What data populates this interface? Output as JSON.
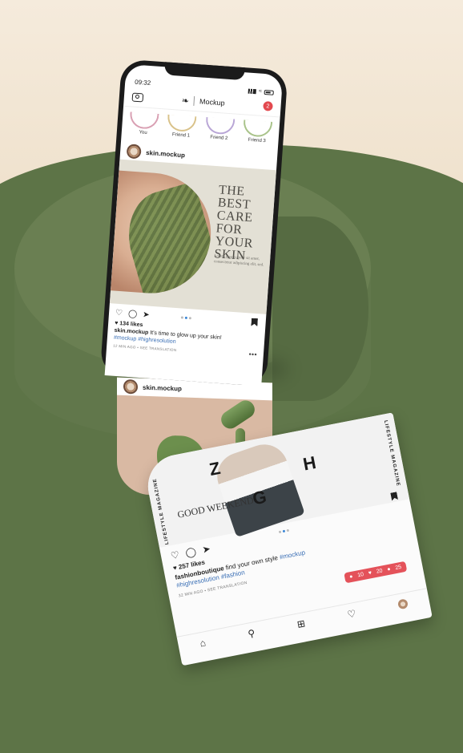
{
  "status_bar": {
    "time": "09:32"
  },
  "top_bar": {
    "brand_glyph": "❧",
    "app_name": "Mockup",
    "notification_count": "2"
  },
  "stories": [
    {
      "label": "You"
    },
    {
      "label": "Friend 1"
    },
    {
      "label": "Friend 2"
    },
    {
      "label": "Friend 3"
    }
  ],
  "post1": {
    "username": "skin.mockup",
    "headline_lines": [
      "THE",
      "BEST",
      "CARE",
      "FOR",
      "YOUR",
      "SKIN"
    ],
    "body_text": "Lorem ipsum dolor sit amet, consectetur adipiscing elit, sed.",
    "likes": "134 likes",
    "caption_user": "skin.mockup",
    "caption_text": "It's time to glow up your skin!",
    "hashtags": "#mockup #highresolution",
    "meta": "12 MIN AGO • SEE TRANSLATION",
    "more": "•••"
  },
  "post2": {
    "username": "skin.mockup"
  },
  "post3": {
    "magazine_left": "LIFESTYLE MAGAZINE",
    "magazine_right": "LIFESTYLE MAGAZINE",
    "letters": [
      "Z",
      "H",
      "G"
    ],
    "headline": "GOOD WEEKEND",
    "likes": "257 likes",
    "caption_user": "fashionboutique",
    "caption_text": "find your own style",
    "hashtags": "#mockup #highresolution #fashion",
    "meta": "32 MIN AGO • SEE TRANSLATION"
  },
  "activity_pill": {
    "followers": "10",
    "likes": "20",
    "comments": "25"
  },
  "colors": {
    "accent_red": "#e4525a",
    "link_blue": "#3a6fb5",
    "background_green": "#5d7447"
  }
}
